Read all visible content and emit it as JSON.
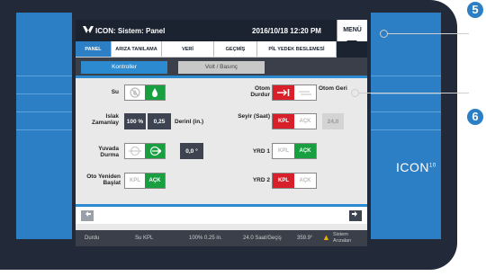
{
  "titlebar": {
    "title": "ICON: Sistem: Panel",
    "datetime": "2016/10/18 12:20 PM",
    "menu_label": "MENÜ"
  },
  "tabs": [
    "PANEL",
    "ARIZA TANILAMA",
    "VERİ",
    "GEÇMİŞ",
    "PİL YEDEK BESLEMESİ"
  ],
  "subtabs": {
    "controls": "Kontroller",
    "volt": "Volt / Basınç"
  },
  "controls": {
    "su": {
      "label": "Su"
    },
    "islak": {
      "label": "Islak Zamanlay",
      "percent": "100 %",
      "depth": "0,25",
      "unit": "Derinl (in.)"
    },
    "yuvada": {
      "label": "Yuvada Durma",
      "value": "0,0 °"
    },
    "oto": {
      "label": "Oto Yeniden Başlat",
      "off": "KPL",
      "on": "AÇK"
    },
    "otom_durdur": {
      "label": "Otom Durdur"
    },
    "otom_geri": {
      "label": "Otom Geri"
    },
    "seyir": {
      "label": "Seyir (Saat)",
      "on": "KPL",
      "off": "AÇK",
      "value": "24,0"
    },
    "yrd1": {
      "label": "YRD 1",
      "off": "KPL",
      "on": "AÇK"
    },
    "yrd2": {
      "label": "YRD 2",
      "on": "KPL",
      "off": "AÇK"
    }
  },
  "status": {
    "state": "Durdu",
    "water": "Su KPL",
    "speed": "100%  0.25 in.",
    "cycle": "24.0 Saat/Geçiş",
    "angle": "359.9°",
    "alarm": "Sistem Arızaları"
  },
  "brand": {
    "name": "ICON",
    "sup": "10"
  },
  "callouts": {
    "c5": "5",
    "c6": "6"
  },
  "colors": {
    "accent": "#2c7fc4",
    "green": "#18a040",
    "red": "#d8202a",
    "dark": "#222a3a"
  }
}
